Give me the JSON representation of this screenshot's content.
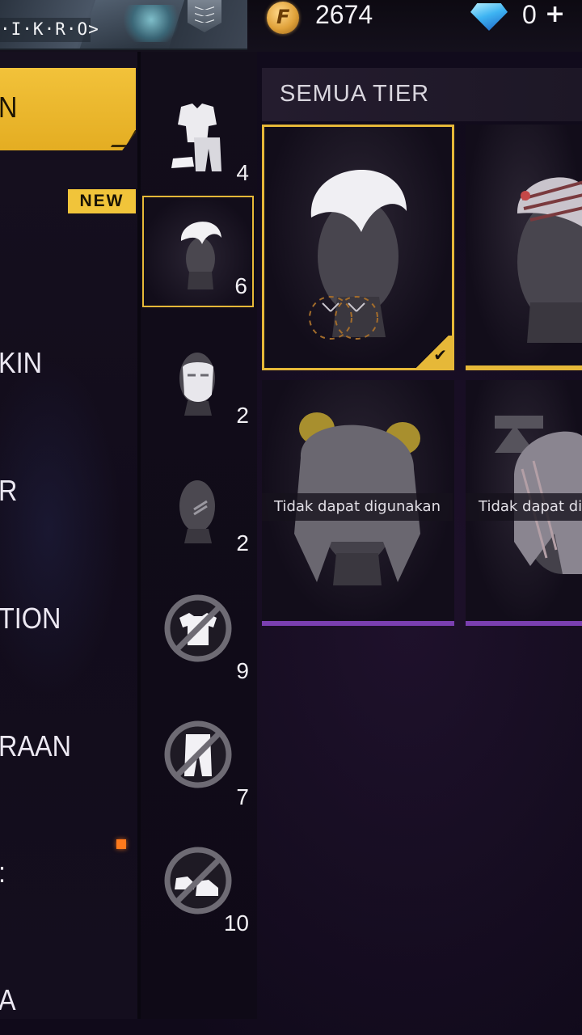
{
  "header": {
    "nickname": "·I·K·R·O>",
    "coins": "2674",
    "diamonds": "0",
    "plus": "+",
    "coin_icon": "gold-coin-icon",
    "diamond_icon": "diamond-icon"
  },
  "sidebar": {
    "items": [
      {
        "label": "N",
        "active": true
      },
      {
        "label": "KIN",
        "active": false
      },
      {
        "label": "R",
        "active": false
      },
      {
        "label": "TION",
        "active": false
      },
      {
        "label": "RAAN",
        "active": false
      },
      {
        "label": ":",
        "active": false
      },
      {
        "label": "A",
        "active": false
      }
    ],
    "new_badge": "NEW"
  },
  "slots": [
    {
      "icon": "outfit-icon",
      "count": "4"
    },
    {
      "icon": "hair-icon",
      "count": "6",
      "selected": true
    },
    {
      "icon": "mask-icon",
      "count": "2"
    },
    {
      "icon": "face-paint-icon",
      "count": "2"
    },
    {
      "icon": "no-top-icon",
      "count": "9"
    },
    {
      "icon": "no-pants-icon",
      "count": "7"
    },
    {
      "icon": "no-shoes-icon",
      "count": "10"
    }
  ],
  "tier_filter": "SEMUA TIER",
  "cards": [
    {
      "name": "white-hair-item",
      "selected": true,
      "label": ""
    },
    {
      "name": "striped-hair-item",
      "selected": false,
      "label": ""
    },
    {
      "name": "bear-ears-hair-item",
      "selected": false,
      "label": "Tidak dapat digunakan"
    },
    {
      "name": "long-hair-item",
      "selected": false,
      "label": "Tidak dapat di"
    }
  ],
  "colors": {
    "accent": "#e6b838",
    "rarity_gold": "#e6b838",
    "rarity_purple": "#7a3fb0",
    "background": "#0c0814"
  }
}
